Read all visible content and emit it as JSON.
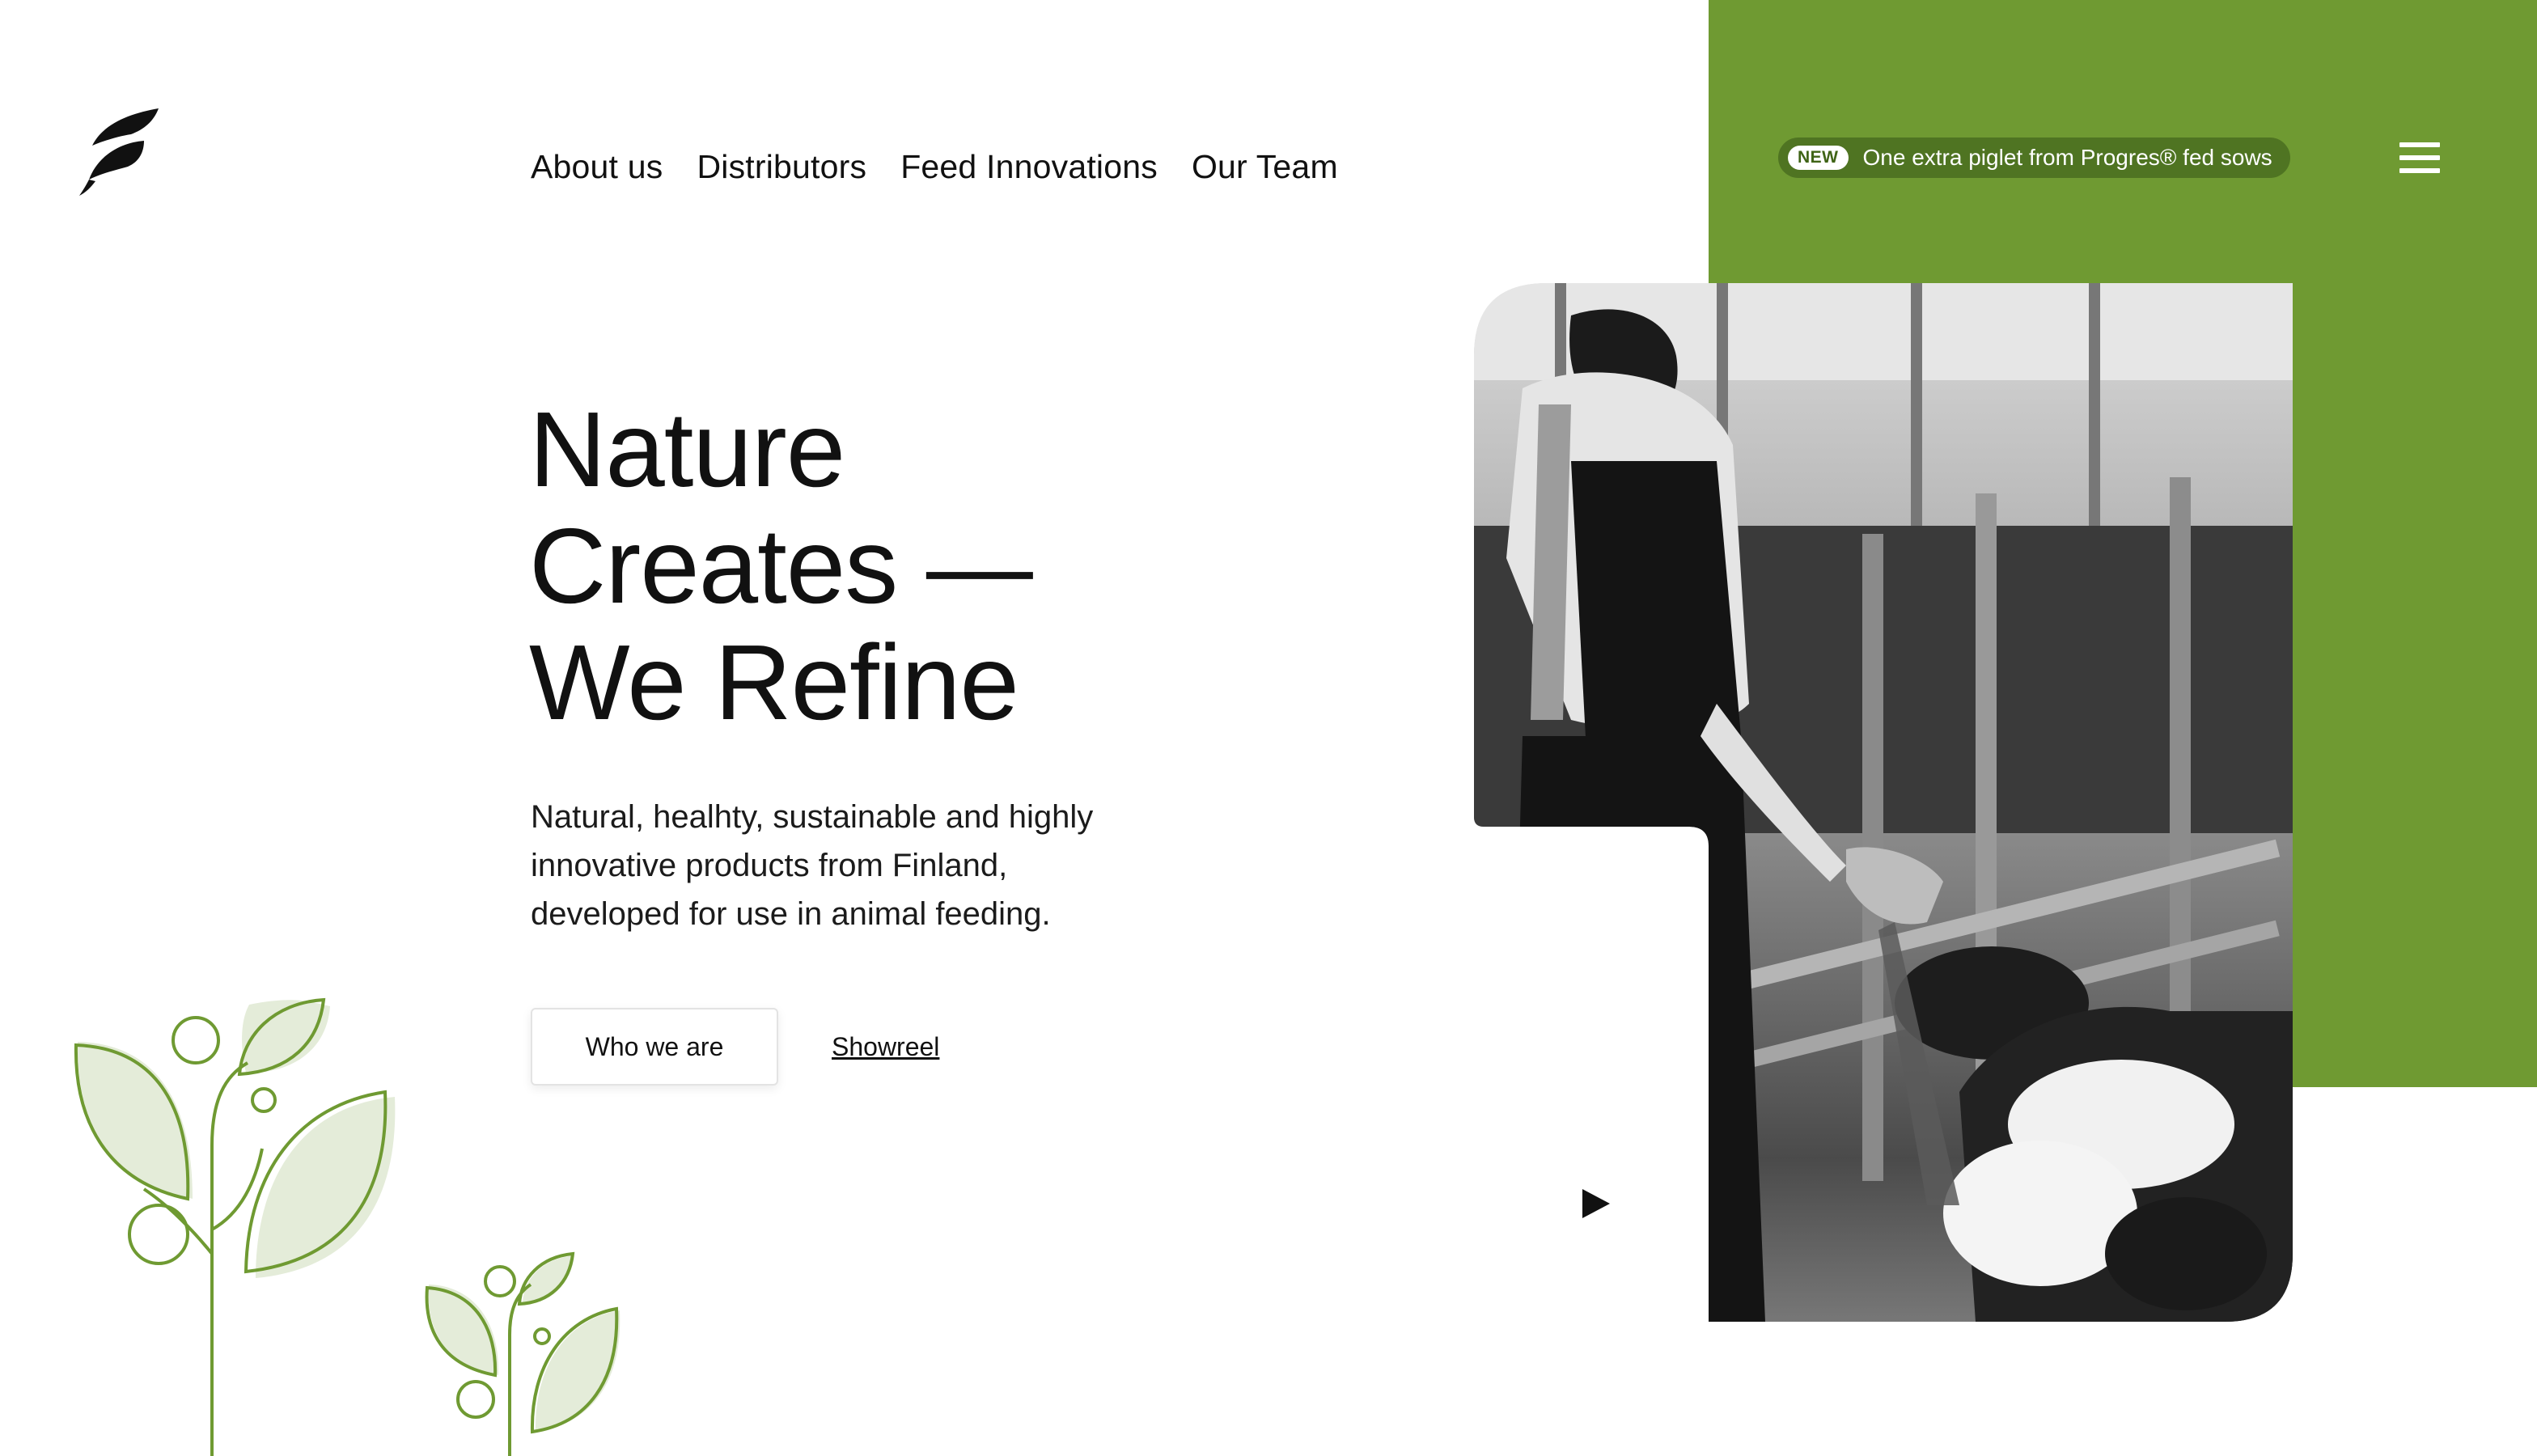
{
  "nav": {
    "items": [
      {
        "label": "About us"
      },
      {
        "label": "Distributors"
      },
      {
        "label": "Feed Innovations"
      },
      {
        "label": "Our Team"
      }
    ]
  },
  "announcement": {
    "badge": "NEW",
    "text": "One extra piglet from Progres® fed sows"
  },
  "hero": {
    "title_lines": [
      "Nature",
      "Creates —",
      "We Refine"
    ],
    "description": "Natural, healhty, sustainable and highly innovative products from Finland, developed for use in animal feeding.",
    "primary_button": "Who we are",
    "secondary_link": "Showreel"
  },
  "icons": {
    "logo": "leaf-logo-icon",
    "menu": "hamburger-menu-icon",
    "play": "play-icon"
  },
  "colors": {
    "brand_green": "#6f9a32",
    "badge_green": "#4f7422",
    "leaf_outline": "#6f9a32",
    "leaf_fill": "#e4ecd9",
    "text": "#111111"
  }
}
